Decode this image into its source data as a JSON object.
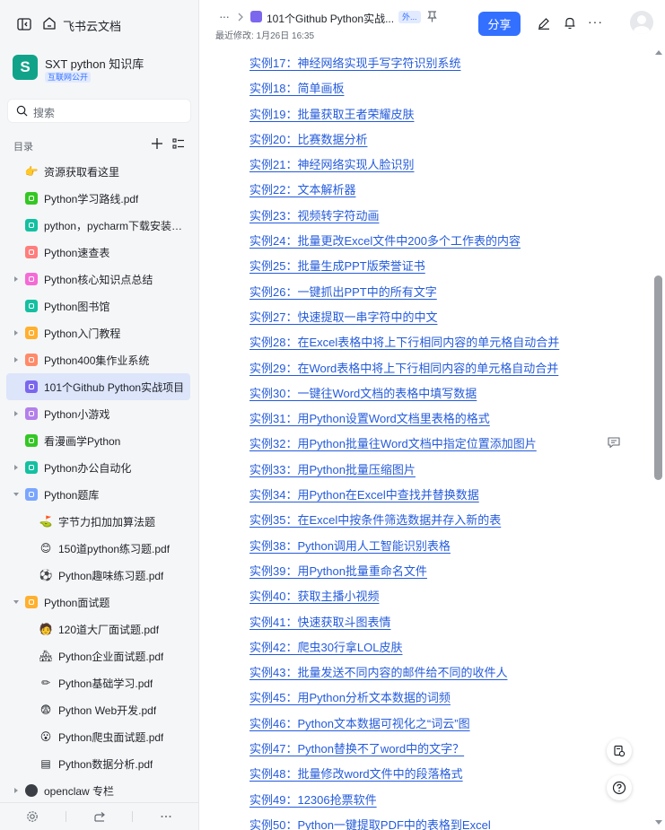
{
  "app": {
    "site_name": "飞书云文档",
    "knowledge_base": {
      "avatar_letter": "S",
      "name": "SXT python 知识库",
      "badge": "互联网公开",
      "color": "#11a38a"
    }
  },
  "sidebar": {
    "search_placeholder": "搜索",
    "toc_title": "目录",
    "items": [
      {
        "label": "资源获取看这里",
        "icon": "pointing-hand-icon",
        "glyph": "👉",
        "level": 0,
        "caret": false,
        "color": ""
      },
      {
        "label": "Python学习路线.pdf",
        "icon": "sheet-icon",
        "glyph": "",
        "level": 0,
        "caret": false,
        "color": "#34c724"
      },
      {
        "label": "python，pycharm下载安装教...",
        "icon": "doc-icon",
        "glyph": "",
        "level": 0,
        "caret": false,
        "color": "#14c0a1"
      },
      {
        "label": "Python速查表",
        "icon": "doc-icon",
        "glyph": "",
        "level": 0,
        "caret": false,
        "color": "#ff7d7d"
      },
      {
        "label": "Python核心知识点总结",
        "icon": "doc-icon",
        "glyph": "",
        "level": 0,
        "caret": true,
        "color": "#f46bd6"
      },
      {
        "label": "Python图书馆",
        "icon": "doc-icon",
        "glyph": "",
        "level": 0,
        "caret": false,
        "color": "#14c0a1"
      },
      {
        "label": "Python入门教程",
        "icon": "doc-icon",
        "glyph": "",
        "level": 0,
        "caret": true,
        "color": "#ffb02e"
      },
      {
        "label": "Python400集作业系统",
        "icon": "doc-icon",
        "glyph": "",
        "level": 0,
        "caret": true,
        "color": "#ff8a6a"
      },
      {
        "label": "101个Github Python实战项目",
        "icon": "doc-icon",
        "glyph": "",
        "level": 0,
        "caret": false,
        "color": "#7b67ee",
        "active": true
      },
      {
        "label": "Python小游戏",
        "icon": "doc-icon",
        "glyph": "",
        "level": 0,
        "caret": true,
        "color": "#b37feb"
      },
      {
        "label": "看漫画学Python",
        "icon": "chart-icon",
        "glyph": "",
        "level": 0,
        "caret": false,
        "color": "#34c724"
      },
      {
        "label": "Python办公自动化",
        "icon": "doc-icon",
        "glyph": "",
        "level": 0,
        "caret": true,
        "color": "#14c0a1"
      },
      {
        "label": "Python题库",
        "icon": "doc-icon",
        "glyph": "",
        "level": 0,
        "caret": "open",
        "color": "#7aa6ff"
      },
      {
        "label": "字节力扣加加算法题",
        "icon": "rocket-icon",
        "glyph": "⛳",
        "level": 1,
        "caret": false,
        "color": ""
      },
      {
        "label": "150道python练习题.pdf",
        "icon": "smile-icon",
        "glyph": "😊",
        "level": 1,
        "caret": false,
        "color": ""
      },
      {
        "label": "Python趣味练习题.pdf",
        "icon": "soccer-icon",
        "glyph": "⚽",
        "level": 1,
        "caret": false,
        "color": ""
      },
      {
        "label": "Python面试题",
        "icon": "doc-icon",
        "glyph": "",
        "level": 0,
        "caret": "open",
        "color": "#ffb02e"
      },
      {
        "label": "120道大厂面试题.pdf",
        "icon": "person-icon",
        "glyph": "🧑",
        "level": 1,
        "caret": false,
        "color": ""
      },
      {
        "label": "Python企业面试题.pdf",
        "icon": "house-icon",
        "glyph": "🏘",
        "level": 1,
        "caret": false,
        "color": ""
      },
      {
        "label": "Python基础学习.pdf",
        "icon": "pencil-icon",
        "glyph": "✏",
        "level": 1,
        "caret": false,
        "color": ""
      },
      {
        "label": "Python Web开发.pdf",
        "icon": "face-icon",
        "glyph": "😨",
        "level": 1,
        "caret": false,
        "color": ""
      },
      {
        "label": "Python爬虫面试题.pdf",
        "icon": "surprised-icon",
        "glyph": "😮",
        "level": 1,
        "caret": false,
        "color": ""
      },
      {
        "label": "Python数据分析.pdf",
        "icon": "terminal-icon",
        "glyph": "▤",
        "level": 1,
        "caret": false,
        "color": ""
      },
      {
        "label": "openclaw 专栏",
        "icon": "claw-icon",
        "glyph": "",
        "level": 0,
        "caret": true,
        "color": "#3b3f45"
      }
    ]
  },
  "header": {
    "breadcrumb_more": "···",
    "doc_title": "101个Github Python实战...",
    "tag": "外...",
    "last_modified": "最近修改: 1月26日 16:35",
    "share_label": "分享",
    "more": "···"
  },
  "lessons": [
    "实例17：神经网络实现手写字符识别系统",
    "实例18：简单画板",
    "实例19：批量获取王者荣耀皮肤",
    "实例20：比赛数据分析",
    "实例21：神经网络实现人脸识别",
    "实例22：文本解析器",
    "实例23：视频转字符动画",
    "实例24：批量更改Excel文件中200多个工作表的内容",
    "实例25：批量生成PPT版荣誉证书",
    "实例26：一键抓出PPT中的所有文字",
    "实例27：快速提取一串字符中的中文",
    "实例28：在Excel表格中将上下行相同内容的单元格自动合并",
    "实例29：在Word表格中将上下行相同内容的单元格自动合并",
    "实例30：一键往Word文档的表格中填写数据",
    "实例31：用Python设置Word文档里表格的格式",
    "实例32：用Python批量往Word文档中指定位置添加图片",
    "实例33：用Python批量压缩图片",
    "实例34：用Python在Excel中查找并替换数据",
    "实例35：在Excel中按条件筛选数据并存入新的表",
    "实例38：Python调用人工智能识别表格",
    "实例39：用Python批量重命名文件",
    "实例40：获取主播小视频",
    "实例41：快速获取斗图表情",
    "实例42：爬虫30行拿LOL皮肤",
    "实例43：批量发送不同内容的邮件给不同的收件人",
    "实例45：用Python分析文本数据的词频",
    "实例46：Python文本数据可视化之“词云”图",
    "实例47：Python替换不了word中的文字？",
    "实例48：批量修改word文件中的段落格式",
    "实例49：12306抢票软件",
    "实例50：Python一键提取PDF中的表格到Excel"
  ],
  "colors": {
    "accent": "#3370ff",
    "link": "#245bdb",
    "sidebar_bg": "#f5f6f7",
    "active_bg": "#dde5fb"
  }
}
